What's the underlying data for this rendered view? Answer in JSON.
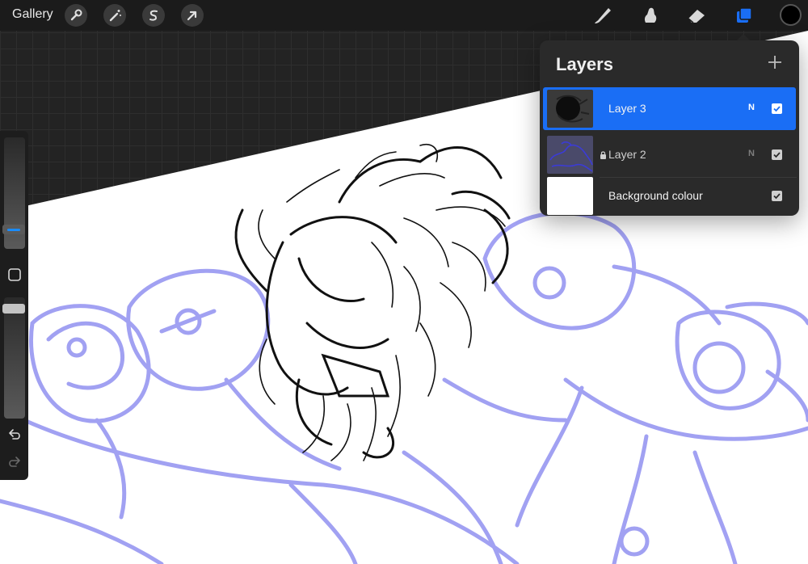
{
  "app": {
    "gallery_label": "Gallery"
  },
  "toolbar": {
    "left_tools": [
      {
        "name": "actions-wrench-icon"
      },
      {
        "name": "adjustments-wand-icon"
      },
      {
        "name": "selection-icon"
      },
      {
        "name": "transform-arrow-icon"
      }
    ],
    "right_tools": [
      {
        "name": "brush-icon"
      },
      {
        "name": "smudge-icon"
      },
      {
        "name": "eraser-icon"
      },
      {
        "name": "layers-icon",
        "active": true
      }
    ],
    "current_color": "#000000",
    "accent_color": "#1a6ef5"
  },
  "sidebar": {
    "brush_size_icon": "brush-size-slider",
    "modify_icon": "square-icon",
    "opacity_icon": "opacity-slider",
    "undo_icon": "undo-icon",
    "redo_icon": "redo-icon"
  },
  "layers_panel": {
    "title": "Layers",
    "add_icon": "plus-icon",
    "layers": [
      {
        "name": "Layer 3",
        "blend": "N",
        "visible": true,
        "selected": true,
        "locked": false
      },
      {
        "name": "Layer 2",
        "blend": "N",
        "visible": true,
        "selected": false,
        "locked": true
      },
      {
        "name": "Background colour",
        "visible": true,
        "selected": false,
        "locked": false
      }
    ]
  }
}
